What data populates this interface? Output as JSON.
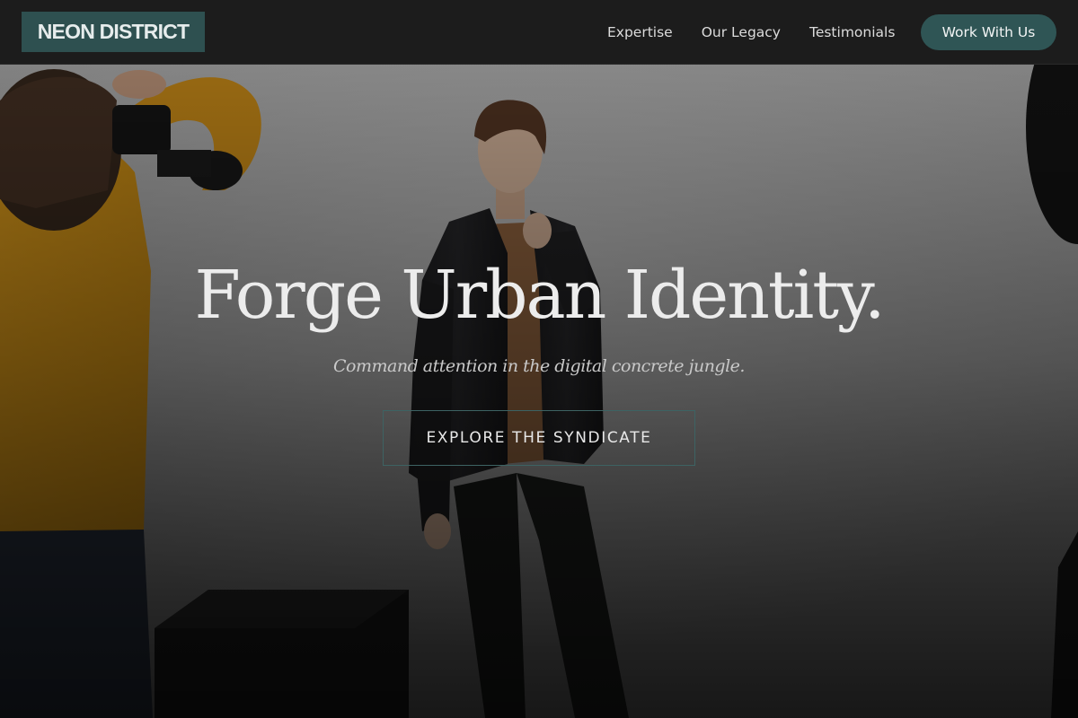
{
  "brand": {
    "logo_text": "NEON DISTRICT",
    "accent_color": "#2e5050"
  },
  "nav": {
    "items": [
      {
        "label": "Expertise"
      },
      {
        "label": "Our Legacy"
      },
      {
        "label": "Testimonials"
      }
    ],
    "cta_label": "Work With Us"
  },
  "hero": {
    "title": "Forge Urban Identity.",
    "subtitle": "Command attention in the digital concrete jungle.",
    "button_label": "EXPLORE THE SYNDICATE",
    "image_description_icon": "photo-studio-shoot-image"
  }
}
